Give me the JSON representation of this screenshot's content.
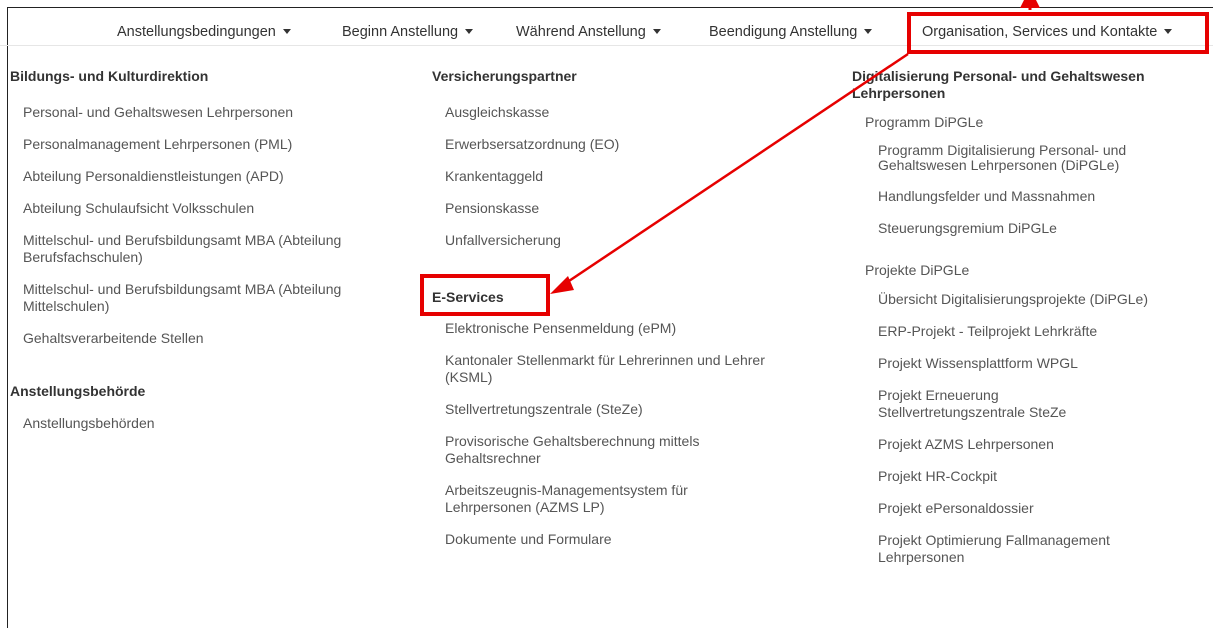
{
  "nav": [
    {
      "label": "Anstellungsbedingungen"
    },
    {
      "label": "Beginn Anstellung"
    },
    {
      "label": "Während Anstellung"
    },
    {
      "label": "Beendigung Anstellung"
    },
    {
      "label": "Organisation, Services und Kontakte"
    }
  ],
  "col1": {
    "heading1": "Bildungs- und Kulturdirektion",
    "items": [
      "Personal- und Gehaltswesen Lehrpersonen",
      "Personalmanagement Lehrpersonen (PML)",
      "Abteilung Personaldienstleistungen (APD)",
      "Abteilung Schulaufsicht Volksschulen",
      "Mittelschul- und Berufsbildungsamt MBA (Abteilung Berufsfachschulen)",
      "Mittelschul- und Berufsbildungsamt MBA (Abteilung Mittelschulen)",
      "Gehaltsverarbeitende Stellen"
    ],
    "heading2": "Anstellungsbehörde",
    "items2": [
      "Anstellungsbehörden"
    ]
  },
  "col2": {
    "heading1": "Versicherungspartner",
    "items": [
      "Ausgleichskasse",
      "Erwerbsersatzordnung (EO)",
      "Krankentaggeld",
      "Pensionskasse",
      "Unfallversicherung"
    ],
    "heading2": "E-Services",
    "items2": [
      "Elektronische Pensenmeldung (ePM)",
      "Kantonaler Stellenmarkt für Lehrerinnen und Lehrer (KSML)",
      "Stellvertretungszentrale (SteZe)",
      "Provisorische Gehaltsberechnung mittels Gehaltsrechner",
      "Arbeitszeugnis-Managementsystem für Lehrpersonen (AZMS LP)",
      "Dokumente und Formulare"
    ]
  },
  "col3": {
    "heading": "Digitalisierung Personal- und Gehaltswesen Lehrpersonen",
    "sub1": "Programm DiPGLe",
    "sub1_items": [
      "Programm Digitalisierung Personal- und Gehaltswesen Lehrpersonen (DiPGLe)",
      "Handlungsfelder und Massnahmen",
      "Steuerungsgremium DiPGLe"
    ],
    "sub2": "Projekte DiPGLe",
    "sub2_items": [
      "Übersicht Digitalisierungsprojekte (DiPGLe)",
      "ERP-Projekt - Teilprojekt Lehrkräfte",
      "Projekt Wissensplattform WPGL",
      "Projekt Erneuerung Stellvertretungszentrale SteZe",
      "Projekt AZMS Lehrpersonen",
      "Projekt HR-Cockpit",
      "Projekt ePersonaldossier",
      "Projekt Optimierung Fallmanagement Lehrpersonen"
    ]
  },
  "colors": {
    "highlight": "#e60000",
    "text": "#555555",
    "heading": "#333333"
  }
}
